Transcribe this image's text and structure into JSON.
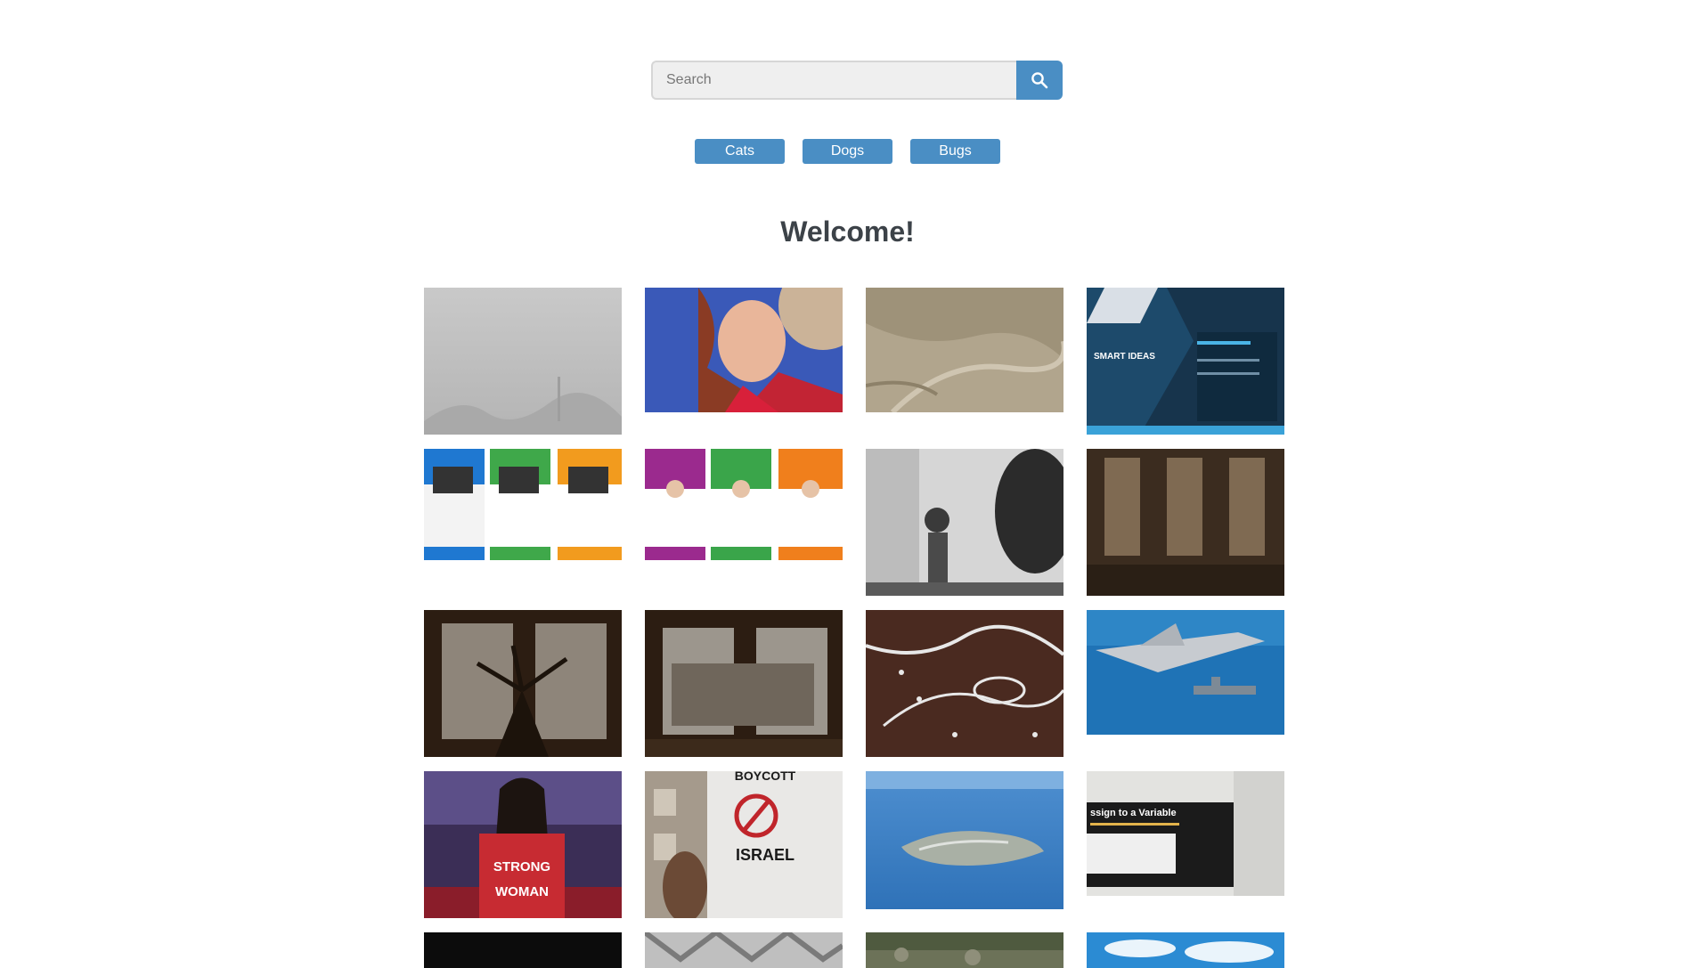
{
  "search": {
    "placeholder": "Search",
    "value": "",
    "button_icon": "search-icon"
  },
  "categories": [
    {
      "label": "Cats"
    },
    {
      "label": "Dogs"
    },
    {
      "label": "Bugs"
    }
  ],
  "heading": "Welcome!",
  "colors": {
    "accent": "#4a8ec4",
    "heading": "#3c4248",
    "search_bg": "#efefef"
  },
  "gallery": {
    "images": [
      {
        "subject": "foggy gray landscape"
      },
      {
        "subject": "superhero woman portrait"
      },
      {
        "subject": "aerial desert canyon"
      },
      {
        "subject": "blue corporate brochure"
      },
      {
        "subject": "business flyer templates"
      },
      {
        "subject": "business flyer templates with man"
      },
      {
        "subject": "black and white man in profile"
      },
      {
        "subject": "sepia interior with tall windows"
      },
      {
        "subject": "window silhouette with palm"
      },
      {
        "subject": "window view of building"
      },
      {
        "subject": "white pattern on brown surface"
      },
      {
        "subject": "fighter jet over ocean and carrier"
      },
      {
        "subject": "woman in strong woman shirt"
      },
      {
        "subject": "boycott israel graffiti wall"
      },
      {
        "subject": "aerial island in the sea"
      },
      {
        "subject": "screen showing code"
      },
      {
        "subject": "dark image"
      },
      {
        "subject": "gray architecture"
      },
      {
        "subject": "rocky landscape"
      },
      {
        "subject": "sky with clouds"
      }
    ],
    "visible_text": {
      "brochure_heading": "SMART IDEAS",
      "shirt_line1": "STRONG",
      "shirt_line2": "WOMAN",
      "graffiti_top": "BOYCOTT",
      "graffiti_bottom": "ISRAEL",
      "code_title": "ssign to a Variable"
    }
  }
}
